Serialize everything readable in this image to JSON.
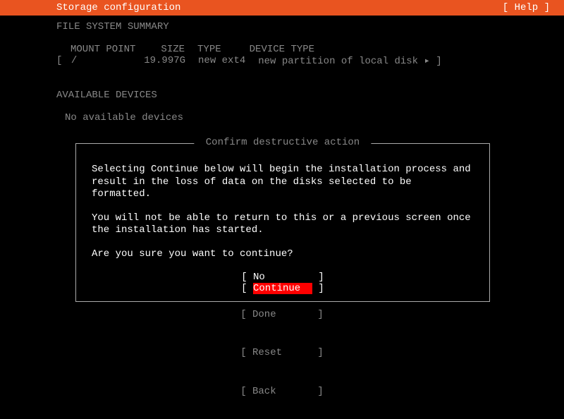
{
  "header": {
    "title": "Storage configuration",
    "help": "[ Help ]"
  },
  "sections": {
    "file_system_summary": "FILE SYSTEM SUMMARY",
    "available_devices": "AVAILABLE DEVICES"
  },
  "fs_table": {
    "headers": {
      "mount_point": "MOUNT POINT",
      "size": "SIZE",
      "type": "TYPE",
      "device_type": "DEVICE TYPE"
    },
    "row": {
      "open": "[ ",
      "mount_point": "/",
      "size": "19.997G",
      "type": "new ext4",
      "device_type": "new partition of local disk ▸ ]"
    }
  },
  "available": {
    "text": "No available devices"
  },
  "dialog": {
    "title": " Confirm destructive action ",
    "para1": "Selecting Continue below will begin the installation process and result in the loss of data on the disks selected to be formatted.",
    "para2": "You will not be able to return to this or a previous screen once the installation has started.",
    "para3": "Are you sure you want to continue?",
    "no_label": "[ No         ]",
    "continue_open": "[ ",
    "continue_label": "Continue  ",
    "continue_close": " ]"
  },
  "bottom": {
    "done": "[ Done       ]",
    "reset": "[ Reset      ]",
    "back": "[ Back       ]"
  }
}
